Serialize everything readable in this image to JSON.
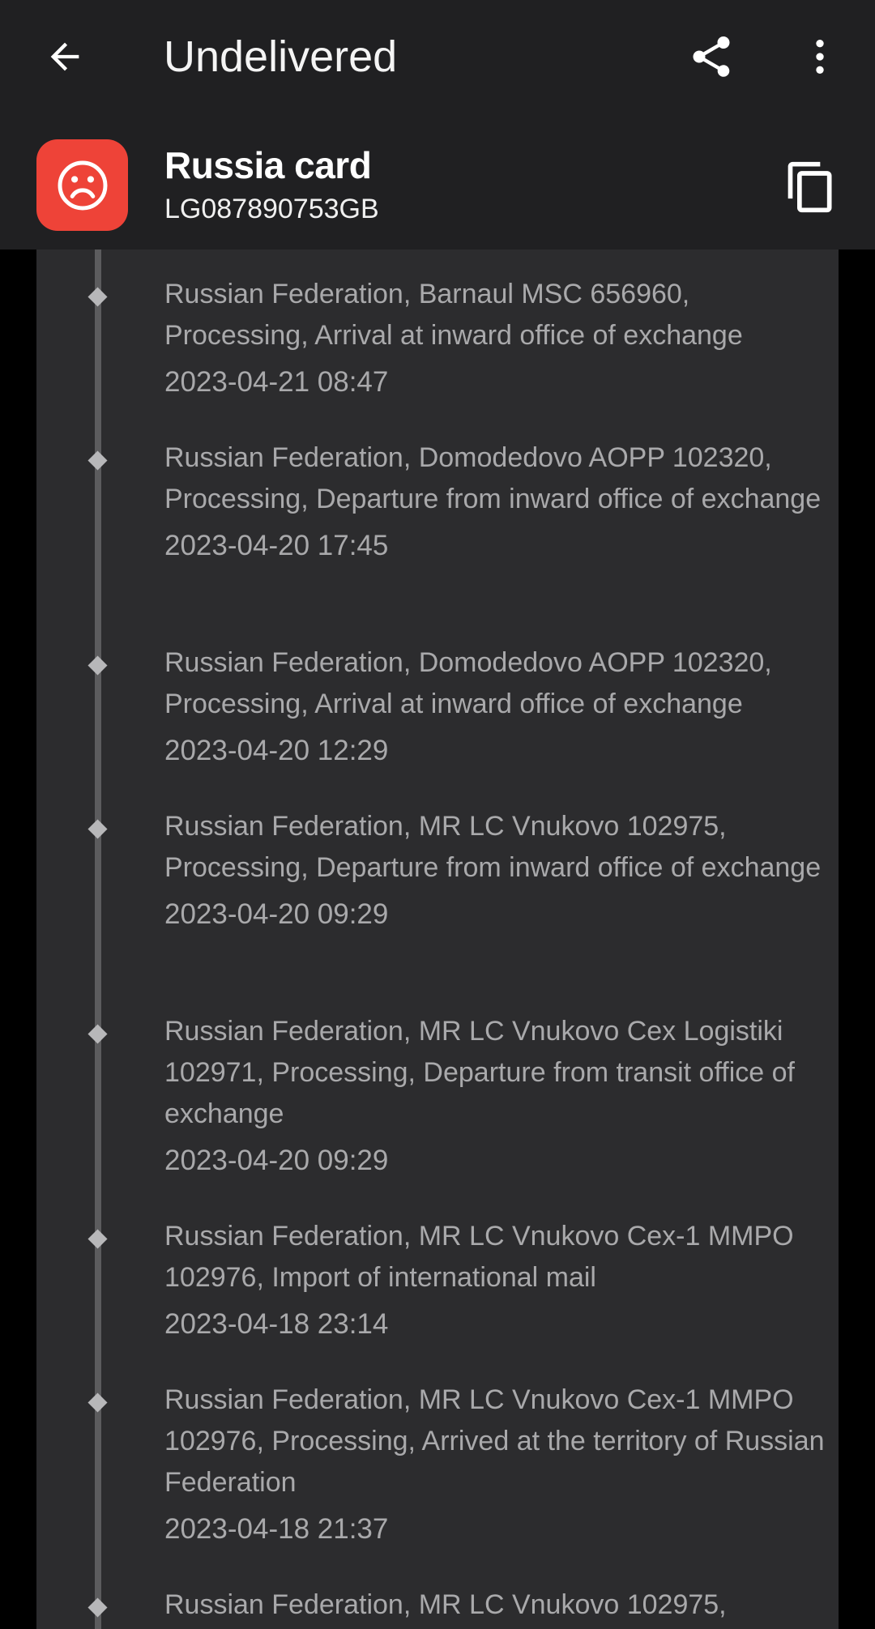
{
  "app_bar": {
    "title": "Undelivered",
    "back_icon": "arrow-left-icon",
    "share_icon": "share-icon",
    "more_icon": "more-vertical-icon"
  },
  "parcel": {
    "name": "Russia card",
    "tracking_number": "LG087890753GB",
    "status_icon": "sad-face-icon",
    "status_color": "#ee4338",
    "copy_icon": "copy-icon"
  },
  "events": [
    {
      "description": "Russian Federation, Barnaul MSC 656960, Processing, Arrival at inward office of exchange",
      "date": "2023-04-21 08:47"
    },
    {
      "description": "Russian Federation, Domodedovo AOPP 102320, Processing, Departure from inward office of exchange",
      "date": "2023-04-20 17:45"
    },
    {
      "description": "Russian Federation, Domodedovo AOPP 102320, Processing, Arrival at inward office of exchange",
      "date": "2023-04-20 12:29"
    },
    {
      "description": "Russian Federation, MR LC Vnukovo 102975, Processing, Departure from inward office of exchange",
      "date": "2023-04-20 09:29"
    },
    {
      "description": "Russian Federation, MR LC Vnukovo Cex Logistiki 102971, Processing, Departure from transit office of exchange",
      "date": "2023-04-20 09:29"
    },
    {
      "description": "Russian Federation, MR LC Vnukovo Cex-1 MMPO 102976, Import of international mail",
      "date": "2023-04-18 23:14"
    },
    {
      "description": "Russian Federation, MR LC Vnukovo Cex-1 MMPO 102976, Processing, Arrived at the territory of Russian Federation",
      "date": "2023-04-18 21:37"
    },
    {
      "description": "Russian Federation, MR LC Vnukovo 102975,",
      "date": ""
    }
  ]
}
